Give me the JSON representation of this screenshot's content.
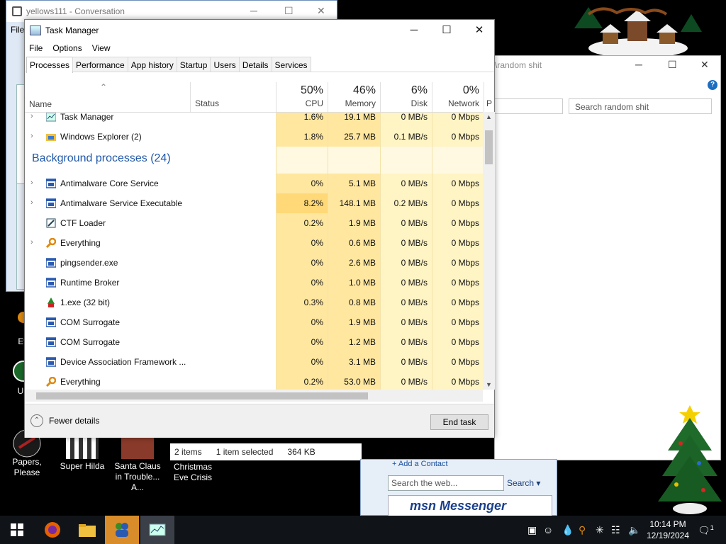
{
  "background_windows": {
    "conversation": {
      "title": "yellows111 - Conversation",
      "menu_letters": "File"
    },
    "explorer": {
      "title": "\\random shit",
      "search_placeholder": "Search random shit"
    },
    "status": {
      "items": "2 items",
      "selected": "1 item selected",
      "size": "364 KB"
    },
    "msn": {
      "add_contact": "+ Add a Contact",
      "search_placeholder": "Search the web...",
      "search_label": "Search",
      "logo_text": "msn Messenger"
    }
  },
  "desktop_icons": [
    {
      "label": "Ever",
      "icon": "everything-icon"
    },
    {
      "label": "Unc",
      "icon": "app-icon"
    },
    {
      "label": "Papers, Please",
      "icon": "papers-please-icon"
    },
    {
      "label": "Super Hilda",
      "icon": "super-hilda-icon"
    },
    {
      "label": "Santa Claus in Trouble... A...",
      "icon": "santa-icon"
    },
    {
      "label": "Christmas Eve Crisis",
      "icon": "christmas-icon"
    }
  ],
  "task_manager": {
    "title": "Task Manager",
    "window_controls": {
      "minimize": "─",
      "maximize": "☐",
      "close": "✕"
    },
    "menu": [
      "File",
      "Options",
      "View"
    ],
    "tabs": [
      "Processes",
      "Performance",
      "App history",
      "Startup",
      "Users",
      "Details",
      "Services"
    ],
    "active_tab": "Processes",
    "columns": {
      "name": "Name",
      "status": "Status",
      "cpu": {
        "pct": "50%",
        "label": "CPU"
      },
      "memory": {
        "pct": "46%",
        "label": "Memory"
      },
      "disk": {
        "pct": "6%",
        "label": "Disk"
      },
      "network": {
        "pct": "0%",
        "label": "Network"
      },
      "power": "P"
    },
    "apps_rows": [
      {
        "name": "Task Manager",
        "cpu": "1.6%",
        "mem": "19.1 MB",
        "disk": "0 MB/s",
        "net": "0 Mbps",
        "icon": "task-manager-icon",
        "expand": true
      },
      {
        "name": "Windows Explorer (2)",
        "cpu": "1.8%",
        "mem": "25.7 MB",
        "disk": "0.1 MB/s",
        "net": "0 Mbps",
        "icon": "folder-icon",
        "expand": true
      }
    ],
    "group_label": "Background processes (24)",
    "bg_rows": [
      {
        "name": "Antimalware Core Service",
        "cpu": "0%",
        "mem": "5.1 MB",
        "disk": "0 MB/s",
        "net": "0 Mbps",
        "icon": "service-icon",
        "expand": true
      },
      {
        "name": "Antimalware Service Executable",
        "cpu": "8.2%",
        "mem": "148.1 MB",
        "disk": "0.2 MB/s",
        "net": "0 Mbps",
        "icon": "service-icon",
        "expand": true
      },
      {
        "name": "CTF Loader",
        "cpu": "0.2%",
        "mem": "1.9 MB",
        "disk": "0 MB/s",
        "net": "0 Mbps",
        "icon": "ctf-icon",
        "expand": false
      },
      {
        "name": "Everything",
        "cpu": "0%",
        "mem": "0.6 MB",
        "disk": "0 MB/s",
        "net": "0 Mbps",
        "icon": "search-icon",
        "expand": true
      },
      {
        "name": "pingsender.exe",
        "cpu": "0%",
        "mem": "2.6 MB",
        "disk": "0 MB/s",
        "net": "0 Mbps",
        "icon": "service-icon",
        "expand": false
      },
      {
        "name": "Runtime Broker",
        "cpu": "0%",
        "mem": "1.0 MB",
        "disk": "0 MB/s",
        "net": "0 Mbps",
        "icon": "service-icon",
        "expand": false
      },
      {
        "name": "1.exe (32 bit)",
        "cpu": "0.3%",
        "mem": "0.8 MB",
        "disk": "0 MB/s",
        "net": "0 Mbps",
        "icon": "elf-icon",
        "expand": false
      },
      {
        "name": "COM Surrogate",
        "cpu": "0%",
        "mem": "1.9 MB",
        "disk": "0 MB/s",
        "net": "0 Mbps",
        "icon": "service-icon",
        "expand": false
      },
      {
        "name": "COM Surrogate",
        "cpu": "0%",
        "mem": "1.2 MB",
        "disk": "0 MB/s",
        "net": "0 Mbps",
        "icon": "service-icon",
        "expand": false
      },
      {
        "name": "Device Association Framework ...",
        "cpu": "0%",
        "mem": "3.1 MB",
        "disk": "0 MB/s",
        "net": "0 Mbps",
        "icon": "service-icon",
        "expand": false
      },
      {
        "name": "Everything",
        "cpu": "0.2%",
        "mem": "53.0 MB",
        "disk": "0 MB/s",
        "net": "0 Mbps",
        "icon": "search-icon",
        "expand": false
      }
    ],
    "fewer_details": "Fewer details",
    "end_task": "End task"
  },
  "taskbar": {
    "clock_time": "10:14 PM",
    "clock_date": "12/19/2024",
    "notification_count": "1"
  },
  "colors": {
    "cpu_heat_light": "#fff4c4",
    "cpu_heat": "#ffe7a0",
    "group_blue": "#1f57a8",
    "taskbar": "#101418",
    "active_task": "#d98c2a"
  }
}
